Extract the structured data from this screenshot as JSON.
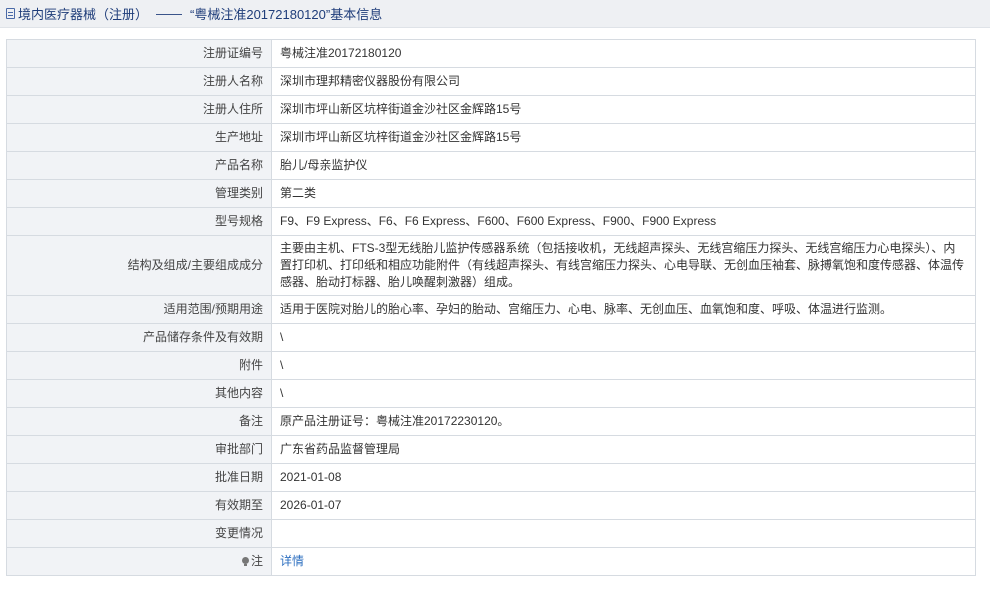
{
  "header": {
    "category": "境内医疗器械（注册）",
    "separator": "——",
    "subject": "“粤械注准20172180120”基本信息"
  },
  "rows": [
    {
      "label": "注册证编号",
      "value": "粤械注准20172180120"
    },
    {
      "label": "注册人名称",
      "value": "深圳市理邦精密仪器股份有限公司"
    },
    {
      "label": "注册人住所",
      "value": "深圳市坪山新区坑梓街道金沙社区金辉路15号"
    },
    {
      "label": "生产地址",
      "value": "深圳市坪山新区坑梓街道金沙社区金辉路15号"
    },
    {
      "label": "产品名称",
      "value": "胎儿/母亲监护仪"
    },
    {
      "label": "管理类别",
      "value": "第二类"
    },
    {
      "label": "型号规格",
      "value": "F9、F9 Express、F6、F6 Express、F600、F600 Express、F900、F900 Express"
    },
    {
      "label": "结构及组成/主要组成成分",
      "value": "主要由主机、FTS-3型无线胎儿监护传感器系统（包括接收机，无线超声探头、无线宫缩压力探头、无线宫缩压力心电探头）、内置打印机、打印纸和相应功能附件（有线超声探头、有线宫缩压力探头、心电导联、无创血压袖套、脉搏氧饱和度传感器、体温传感器、胎动打标器、胎儿唤醒刺激器）组成。"
    },
    {
      "label": "适用范围/预期用途",
      "value": "适用于医院对胎儿的胎心率、孕妇的胎动、宫缩压力、心电、脉率、无创血压、血氧饱和度、呼吸、体温进行监测。"
    },
    {
      "label": "产品储存条件及有效期",
      "value": "\\"
    },
    {
      "label": "附件",
      "value": "\\"
    },
    {
      "label": "其他内容",
      "value": "\\"
    },
    {
      "label": "备注",
      "value": "原产品注册证号：粤械注准20172230120。"
    },
    {
      "label": "审批部门",
      "value": "广东省药品监督管理局"
    },
    {
      "label": "批准日期",
      "value": "2021-01-08"
    },
    {
      "label": "有效期至",
      "value": "2026-01-07"
    },
    {
      "label": "变更情况",
      "value": ""
    }
  ],
  "note": {
    "icon": "lightbulb-icon",
    "label": "注",
    "link_text": "详情"
  },
  "colors": {
    "label_bg": "#f1f3f6",
    "border": "#d6dbe1",
    "link": "#2d6fc0",
    "header_text": "#1f3d7a"
  }
}
